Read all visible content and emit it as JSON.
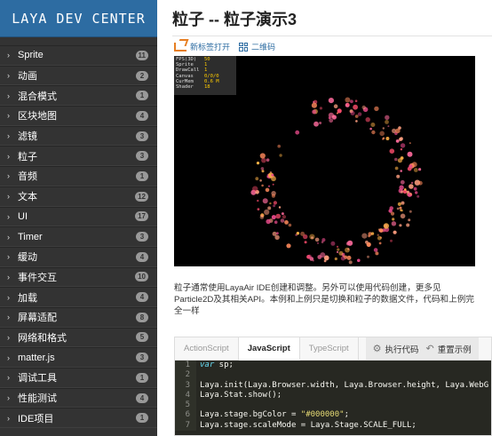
{
  "sidebar": {
    "logo": "LAYA DEV CENTER",
    "items": [
      {
        "label": "Sprite",
        "count": "11"
      },
      {
        "label": "动画",
        "count": "2"
      },
      {
        "label": "混合模式",
        "count": "1"
      },
      {
        "label": "区块地图",
        "count": "4"
      },
      {
        "label": "滤镜",
        "count": "3"
      },
      {
        "label": "粒子",
        "count": "3"
      },
      {
        "label": "音频",
        "count": "1"
      },
      {
        "label": "文本",
        "count": "12"
      },
      {
        "label": "UI",
        "count": "17"
      },
      {
        "label": "Timer",
        "count": "3"
      },
      {
        "label": "缓动",
        "count": "4"
      },
      {
        "label": "事件交互",
        "count": "10"
      },
      {
        "label": "加载",
        "count": "4"
      },
      {
        "label": "屏幕适配",
        "count": "8"
      },
      {
        "label": "网络和格式",
        "count": "5"
      },
      {
        "label": "matter.js",
        "count": "3"
      },
      {
        "label": "调试工具",
        "count": "1"
      },
      {
        "label": "性能测试",
        "count": "4"
      },
      {
        "label": "IDE项目",
        "count": "1"
      }
    ],
    "chevron": "›"
  },
  "main": {
    "title": "粒子 -- 粒子演示3",
    "open_new_tab": "新标签打开",
    "qrcode": "二维码",
    "stats": [
      {
        "key": "FPS(3D)",
        "value": "50"
      },
      {
        "key": "Sprite",
        "value": "1"
      },
      {
        "key": "DrawCall",
        "value": "1"
      },
      {
        "key": "Canvas",
        "value": "0/0/0"
      },
      {
        "key": "CurMem",
        "value": "0.6 M"
      },
      {
        "key": "Shader",
        "value": "18"
      }
    ],
    "description": "粒子通常使用LayaAir IDE创建和调整。另外可以使用代码创建，更多见Particle2D及其相关API。本例和上例只是切换和粒子的数据文件，代码和上例完全一样",
    "tabs": [
      {
        "label": "ActionScript"
      },
      {
        "label": "JavaScript"
      },
      {
        "label": "TypeScript"
      }
    ],
    "run_code": "执行代码",
    "reset": "重置示例"
  },
  "code": {
    "lines": [
      {
        "n": "1",
        "kw": "var",
        "text": " sp;"
      },
      {
        "n": "2",
        "kw": "",
        "text": ""
      },
      {
        "n": "3",
        "kw": "",
        "text": "Laya.init(Laya.Browser.width, Laya.Browser.height, Laya.WebG"
      },
      {
        "n": "4",
        "kw": "",
        "text": "Laya.Stat.show();"
      },
      {
        "n": "5",
        "kw": "",
        "text": ""
      },
      {
        "n": "6",
        "kw": "",
        "text": "Laya.stage.bgColor = ",
        "str": "\"#000000\"",
        "tail": ";"
      },
      {
        "n": "7",
        "kw": "",
        "text": "Laya.stage.scaleMode = Laya.Stage.SCALE_FULL;"
      }
    ]
  },
  "colors": {
    "sidebar_bg": "#333333",
    "logo_bg": "#2d6ca2",
    "link": "#2d6ca2",
    "code_bg": "#272822",
    "particle_colors": [
      "#ff6b9d",
      "#ff8a5c",
      "#ff4d6d",
      "#ffb347",
      "#e84a8a",
      "#ff9f80"
    ]
  }
}
